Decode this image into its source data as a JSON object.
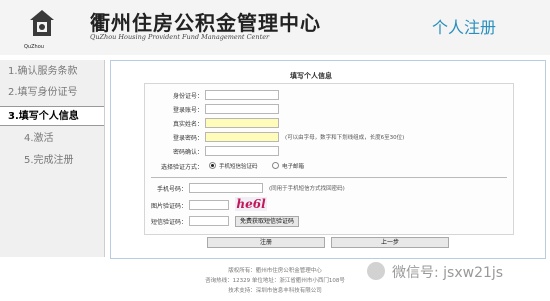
{
  "header": {
    "logo_text": "QuZhou",
    "title_cn": "衢州住房公积金管理中心",
    "title_en": "QuZhou Housing Provident Fund Management Center",
    "page_name": "个人注册"
  },
  "nav": {
    "items": [
      {
        "label": "1.确认服务条款",
        "active": false
      },
      {
        "label": "2.填写身份证号",
        "active": false
      },
      {
        "label": "3.填写个人信息",
        "active": true
      },
      {
        "label": "4.激活",
        "active": false
      },
      {
        "label": "5.完成注册",
        "active": false
      }
    ]
  },
  "form": {
    "title": "填写个人信息",
    "id_label": "身份证号：",
    "id_value": "",
    "account_label": "登录账号：",
    "account_value": "",
    "realname_label": "真实姓名：",
    "realname_value": "",
    "password_label": "登录密码：",
    "password_hint": "(可以由字母，数字和下划线组成，长度6至30位)",
    "confirm_label": "密码确认：",
    "verify_label": "选择验证方式：",
    "option_sms": "手机短信验证码",
    "option_email": "电子邮箱",
    "selected_option": "手机短信验证码",
    "phone_label": "手机号码：",
    "phone_hint": "(同用于手机短信方式找回密码)",
    "image_code_label": "图片验证码：",
    "captcha_text": "he6l",
    "sms_code_label": "短信验证码：",
    "sms_button": "免费获取短信验证码",
    "register_button": "注册",
    "prev_button": "上一步"
  },
  "footer": {
    "line1": "版权所有：衢州市住房公积金管理中心",
    "line2": "咨询热线：12329    单位地址：浙江省衢州市小西门108号",
    "line3": "技术支持：深圳市信息丰科技有限公司"
  },
  "watermark": "微信号: jsxw21js"
}
